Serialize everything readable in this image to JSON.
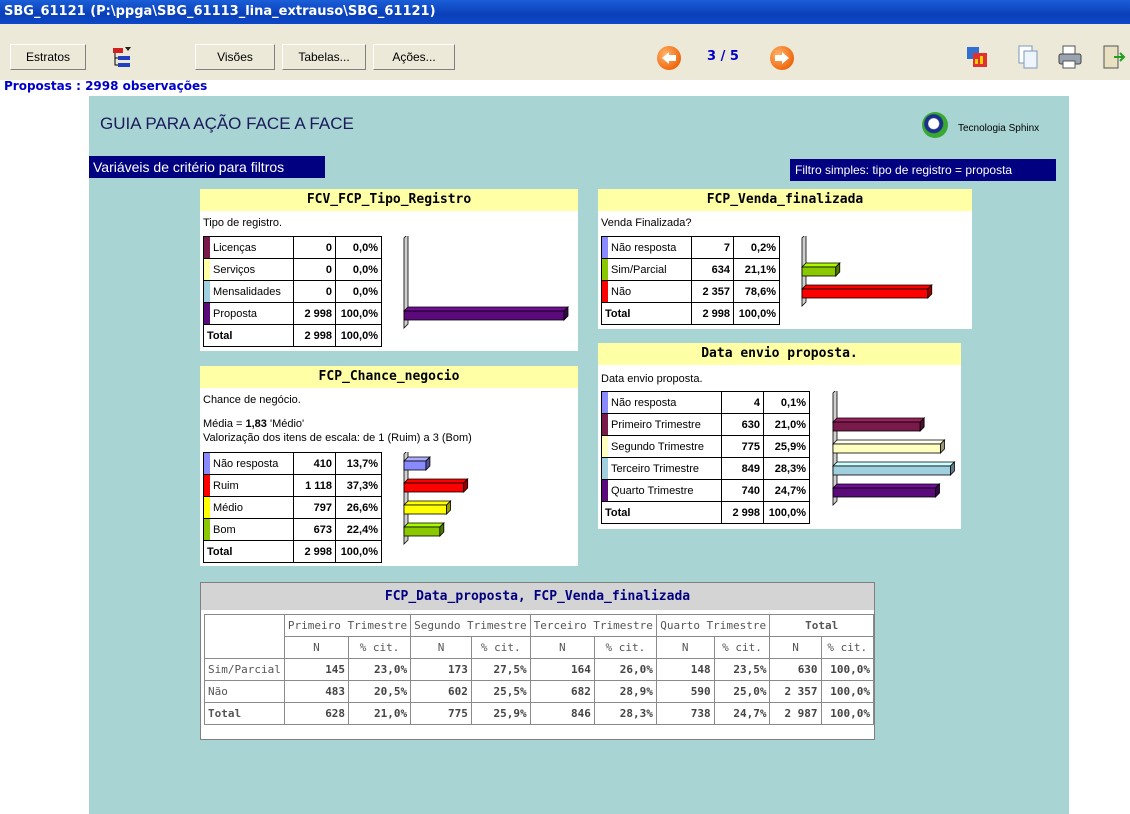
{
  "window_title": "SBG_61121 (P:\\ppga\\SBG_61113_lina_extrauso\\SBG_61121)",
  "toolbar": {
    "estratos": "Estratos",
    "visoes": "Visões",
    "tabelas": "Tabelas...",
    "acoes": "Ações...",
    "page": "3 / 5"
  },
  "observations": "Propostas : 2998 observações",
  "page_title": "GUIA PARA AÇÃO FACE A FACE",
  "brand": "Tecnologia Sphinx",
  "criteria_label": "Variáveis de critério para filtros",
  "filter_label": "Filtro simples: tipo de registro = proposta",
  "panels": {
    "tipo": {
      "title": "FCV_FCP_Tipo_Registro",
      "subtitle": "Tipo de registro.",
      "rows": [
        {
          "label": "Licenças",
          "n": "0",
          "pct": "0,0%",
          "value": 0.0,
          "color": "#7a1a4a"
        },
        {
          "label": "Serviços",
          "n": "0",
          "pct": "0,0%",
          "value": 0.0,
          "color": "#ffffa6"
        },
        {
          "label": "Mensalidades",
          "n": "0",
          "pct": "0,0%",
          "value": 0.0,
          "color": "#a0d0e0"
        },
        {
          "label": "Proposta",
          "n": "2 998",
          "pct": "100,0%",
          "value": 100.0,
          "color": "#5a0a7a"
        }
      ],
      "total": {
        "label": "Total",
        "n": "2 998",
        "pct": "100,0%"
      }
    },
    "venda": {
      "title": "FCP_Venda_finalizada",
      "subtitle": "Venda Finalizada?",
      "rows": [
        {
          "label": "Não resposta",
          "n": "7",
          "pct": "0,2%",
          "value": 0.2,
          "color": "#8a8aff"
        },
        {
          "label": "Sim/Parcial",
          "n": "634",
          "pct": "21,1%",
          "value": 21.1,
          "color": "#8ac800"
        },
        {
          "label": "Não",
          "n": "2 357",
          "pct": "78,6%",
          "value": 78.6,
          "color": "#ff0000"
        }
      ],
      "total": {
        "label": "Total",
        "n": "2 998",
        "pct": "100,0%"
      }
    },
    "chance": {
      "title": "FCP_Chance_negocio",
      "subtitle": "Chance de negócio.",
      "mean_prefix": "Média = ",
      "mean_value": "1,83",
      "mean_suffix": " 'Médio'",
      "scale": "Valorização dos itens de escala: de 1 (Ruim) a 3 (Bom)",
      "rows": [
        {
          "label": "Não resposta",
          "n": "410",
          "pct": "13,7%",
          "value": 13.7,
          "color": "#8a8aff"
        },
        {
          "label": "Ruim",
          "n": "1 118",
          "pct": "37,3%",
          "value": 37.3,
          "color": "#ff0000"
        },
        {
          "label": "Médio",
          "n": "797",
          "pct": "26,6%",
          "value": 26.6,
          "color": "#ffff00"
        },
        {
          "label": "Bom",
          "n": "673",
          "pct": "22,4%",
          "value": 22.4,
          "color": "#8ac800"
        }
      ],
      "total": {
        "label": "Total",
        "n": "2 998",
        "pct": "100,0%"
      }
    },
    "data": {
      "title": "Data envio proposta.",
      "subtitle": "Data envio proposta.",
      "rows": [
        {
          "label": "Não resposta",
          "n": "4",
          "pct": "0,1%",
          "value": 0.1,
          "color": "#8a8aff"
        },
        {
          "label": "Primeiro Trimestre",
          "n": "630",
          "pct": "21,0%",
          "value": 21.0,
          "color": "#7a1a4a"
        },
        {
          "label": "Segundo Trimestre",
          "n": "775",
          "pct": "25,9%",
          "value": 25.9,
          "color": "#ffffc0"
        },
        {
          "label": "Terceiro Trimestre",
          "n": "849",
          "pct": "28,3%",
          "value": 28.3,
          "color": "#a0d0e0"
        },
        {
          "label": "Quarto Trimestre",
          "n": "740",
          "pct": "24,7%",
          "value": 24.7,
          "color": "#5a0a7a"
        }
      ],
      "total": {
        "label": "Total",
        "n": "2 998",
        "pct": "100,0%"
      }
    }
  },
  "cross": {
    "title": "FCP_Data_proposta, FCP_Venda_finalizada",
    "columns": [
      "Primeiro Trimestre",
      "Segundo Trimestre",
      "Terceiro Trimestre",
      "Quarto Trimestre",
      "Total"
    ],
    "sub_n": "N",
    "sub_pct": "% cit.",
    "rows": [
      {
        "label": "Sim/Parcial",
        "cells": [
          "145",
          "23,0%",
          "173",
          "27,5%",
          "164",
          "26,0%",
          "148",
          "23,5%",
          "630",
          "100,0%"
        ]
      },
      {
        "label": "Não",
        "cells": [
          "483",
          "20,5%",
          "602",
          "25,5%",
          "682",
          "28,9%",
          "590",
          "25,0%",
          "2 357",
          "100,0%"
        ]
      },
      {
        "label": "Total",
        "cells": [
          "628",
          "21,0%",
          "775",
          "25,9%",
          "846",
          "28,3%",
          "738",
          "24,7%",
          "2 987",
          "100,0%"
        ]
      }
    ]
  }
}
